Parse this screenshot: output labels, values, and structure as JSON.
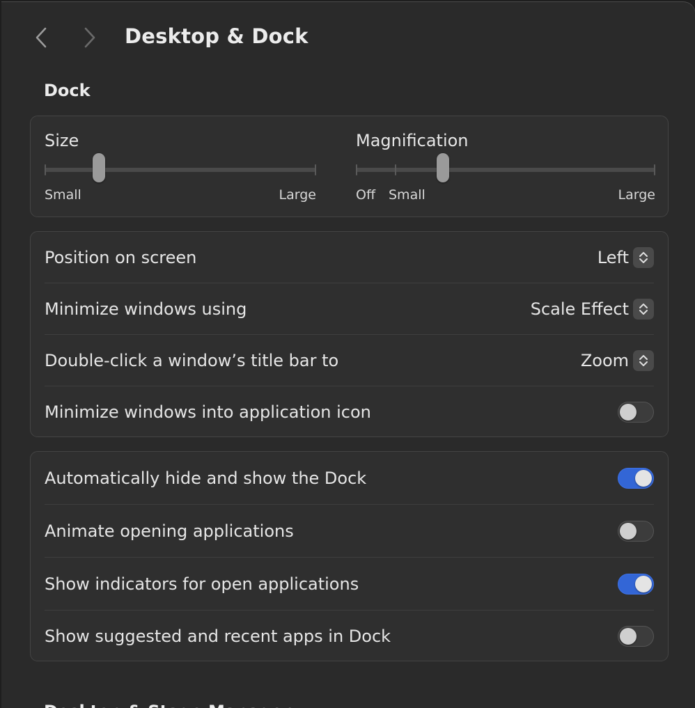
{
  "header": {
    "title": "Desktop & Dock",
    "back_icon": "chevron-left-icon",
    "forward_icon": "chevron-right-icon"
  },
  "dock_section": {
    "title": "Dock",
    "size_slider": {
      "label": "Size",
      "min_label": "Small",
      "max_label": "Large",
      "value": 0.2
    },
    "magnification_slider": {
      "label": "Magnification",
      "off_label": "Off",
      "min_label": "Small",
      "max_label": "Large",
      "value": 0.29
    }
  },
  "options": [
    {
      "label": "Position on screen",
      "value": "Left"
    },
    {
      "label": "Minimize windows using",
      "value": "Scale Effect"
    },
    {
      "label": "Double-click a window’s title bar to",
      "value": "Zoom"
    },
    {
      "label": "Minimize windows into application icon",
      "toggle": false
    }
  ],
  "toggles": [
    {
      "label": "Automatically hide and show the Dock",
      "on": true
    },
    {
      "label": "Animate opening applications",
      "on": false
    },
    {
      "label": "Show indicators for open applications",
      "on": true
    },
    {
      "label": "Show suggested and recent apps in Dock",
      "on": false
    }
  ],
  "next_section": {
    "title": "Desktop & Stage Manager"
  },
  "colors": {
    "accent": "#3366d6",
    "background": "#2a2a2a",
    "card": "#2f2f2f"
  }
}
